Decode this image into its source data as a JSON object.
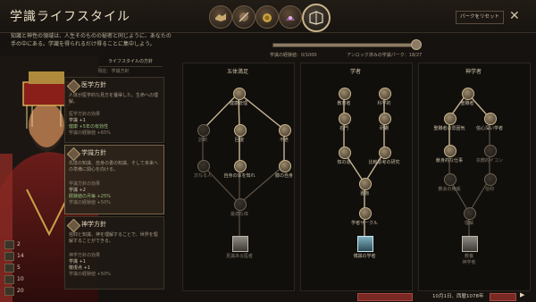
{
  "header": {
    "title": "学識ライフスタイル",
    "reset_label": "パークをリセット",
    "close_glyph": "✕",
    "tabs": [
      {
        "name": "lifestyle-tab-diplomacy",
        "active": false
      },
      {
        "name": "lifestyle-tab-martial",
        "active": false
      },
      {
        "name": "lifestyle-tab-stewardship",
        "active": false
      },
      {
        "name": "lifestyle-tab-intrigue",
        "active": false
      },
      {
        "name": "lifestyle-tab-learning",
        "active": true
      }
    ]
  },
  "intro": "知識と神性の領域は、人生そのものの秘密と同じように、あなたの手の中にある。学識を得られるだけ得ることに集中しよう。",
  "stats": [
    {
      "icon": "diplomacy-icon",
      "value": "2"
    },
    {
      "icon": "martial-icon",
      "value": "14"
    },
    {
      "icon": "stewardship-icon",
      "value": "5"
    },
    {
      "icon": "intrigue-icon",
      "value": "10"
    },
    {
      "icon": "learning-icon",
      "value": "20"
    }
  ],
  "focus_panel": {
    "header": "ライフスタイルの方針",
    "subheader": "現在：学識方針",
    "focuses": [
      {
        "name": "医学方針",
        "desc": "人体が医学的な見方を獲得した。生命への理解。",
        "lines": [
          "医学方針の効果",
          "学識 +1",
          "健康 +5年の有効性",
          "学識の経験値 +65%"
        ],
        "selected": false
      },
      {
        "name": "学識方針",
        "desc": "先達の知識、自身の書の知識、そして未来への準備に関心を向ける。",
        "lines": [
          "学識方針の効果",
          "学識 +2",
          "経験値の月毎 +25%",
          "学識の経験値 +50%"
        ],
        "selected": true
      },
      {
        "name": "神学方針",
        "desc": "信仰と知識、神を理解することで、世界を理解することができる。",
        "lines": [
          "神学方針の効果",
          "学識 +1",
          "敬虔点 +1",
          "学識の経験値 +50%"
        ],
        "selected": false
      }
    ]
  },
  "progress": {
    "exp_label": "学識の経験値：0/1000",
    "perk_label": "アンロック済みの学識パーク：18/27",
    "fraction": 0.95
  },
  "trees": [
    {
      "title": "五体満足",
      "labels": [
        "健康管理",
        "診断",
        "回復",
        "不老",
        "次なる人",
        "自身の体を知れ",
        "膝の自身",
        "最適な体",
        "見識ある医者"
      ]
    },
    {
      "title": "学者",
      "labels": [
        "教育者",
        "科学的",
        "名門",
        "研鑽",
        "知の道",
        "比較思考の研究",
        "書物",
        "学者サークル",
        "博識の学者",
        "学者の学院",
        "忘れ去られた自身",
        "学者"
      ]
    },
    {
      "title": "神学者",
      "labels": [
        "聖職者",
        "聖職者の雰囲気",
        "信心深い学者",
        "献身的な仕事",
        "宗教的イコン",
        "教会の権威",
        "信仰",
        "理解",
        "教養",
        "神学者"
      ]
    }
  ],
  "bottom": {
    "date": "10月1日、西暦1078年",
    "speed": "▶"
  }
}
